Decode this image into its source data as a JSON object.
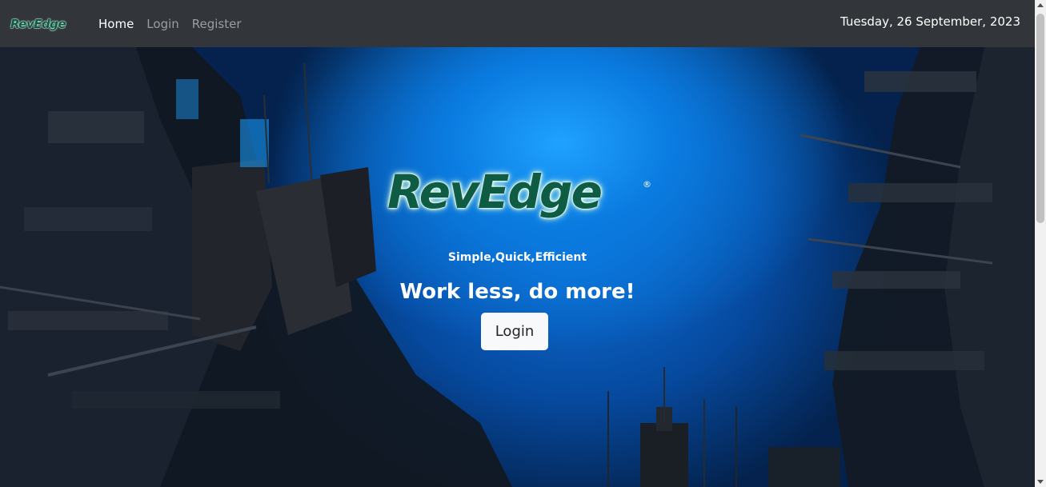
{
  "navbar": {
    "brand": "RevEdge",
    "links": [
      {
        "label": "Home",
        "active": true
      },
      {
        "label": "Login",
        "active": false
      },
      {
        "label": "Register",
        "active": false
      }
    ],
    "date": "Tuesday, 26 September, 2023"
  },
  "hero": {
    "logo": "RevEdge",
    "registered_mark": "®",
    "tagline": "Simple,Quick,Efficient",
    "headline": "Work less, do more!",
    "login_button": "Login"
  },
  "colors": {
    "navbar_bg": "#32353a",
    "logo_green": "#0e5c43",
    "accent_blue": "#1fa2ff",
    "button_bg": "#f8f9fa"
  }
}
